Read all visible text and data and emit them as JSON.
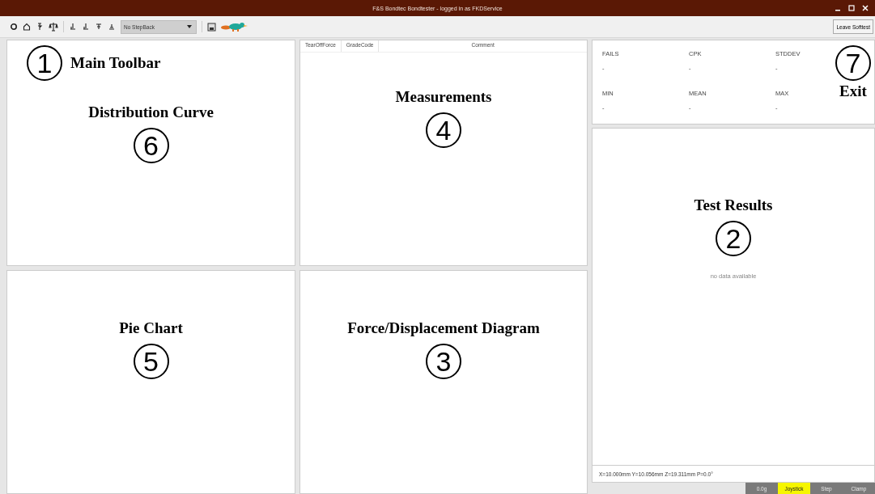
{
  "window": {
    "title": "F&S Bondtec Bondtester - logged in as FKDService"
  },
  "toolbar": {
    "stepback": {
      "value": "No StepBack"
    },
    "leave_button": "Leave Softtest"
  },
  "panels": [
    {
      "annotations": [
        {
          "kind": "inline",
          "number": "1",
          "label": "Main Toolbar"
        },
        {
          "kind": "label-above",
          "number": "6",
          "label": "Distribution Curve"
        }
      ]
    },
    {
      "columns": [
        "TearOffForce",
        "GradeCode",
        "Comment"
      ],
      "annotations": [
        {
          "kind": "label-above",
          "number": "4",
          "label": "Measurements"
        }
      ]
    },
    {
      "annotations": [
        {
          "kind": "label-above",
          "number": "5",
          "label": "Pie Chart"
        }
      ]
    },
    {
      "annotations": [
        {
          "kind": "label-above",
          "number": "3",
          "label": "Force/Displacement Diagram"
        }
      ]
    }
  ],
  "stats": {
    "items": [
      {
        "label": "FAILS",
        "value": "-"
      },
      {
        "label": "CPK",
        "value": "-"
      },
      {
        "label": "STDDEV",
        "value": "-"
      },
      {
        "label": "MIN",
        "value": "-"
      },
      {
        "label": "MEAN",
        "value": "-"
      },
      {
        "label": "MAX",
        "value": "-"
      }
    ],
    "annotation": {
      "kind": "label-below",
      "number": "7",
      "label": "Exit"
    }
  },
  "results": {
    "annotation": {
      "kind": "label-above",
      "number": "2",
      "label": "Test Results"
    },
    "empty_text": "no data available",
    "coordinates": "X=10.000mm Y=10.056mm Z=19.311mm P=0.0°"
  },
  "status_bar": [
    {
      "label": "0.0g",
      "selected": false
    },
    {
      "label": "Joystick",
      "selected": true
    },
    {
      "label": "Step",
      "selected": false
    },
    {
      "label": "Clamp",
      "selected": false
    }
  ]
}
